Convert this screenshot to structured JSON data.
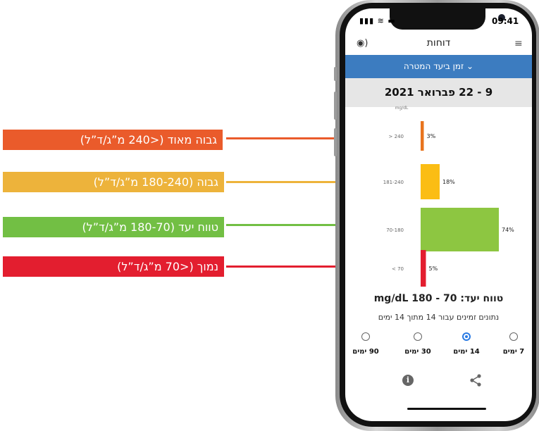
{
  "callouts": [
    {
      "label": "גבוה מאוד (<240 מ”ג/ד”ל)",
      "color": "#ea5b2b"
    },
    {
      "label": "גבוה (180-240 מ”ג/ד”ל)",
      "color": "#edb33b"
    },
    {
      "label": "טווח יעד (180-70 מ”ג/ד”ל)",
      "color": "#72bf44"
    },
    {
      "label": "נמוך (<70 מ”ג/ד”ל)",
      "color": "#e31e2f"
    }
  ],
  "status": {
    "time": "09:41"
  },
  "nav": {
    "title": "דוחות"
  },
  "filter": {
    "label": "זמן ביעד המטרה",
    "icon": "chevron-down-icon"
  },
  "date_range": "9 - 22 פברואר 2021",
  "chart_data": {
    "type": "bar",
    "orientation": "horizontal",
    "unit_label": "mg/dL",
    "categories": [
      "> 240",
      "181-240",
      "70-180",
      "< 70"
    ],
    "values": [
      3,
      18,
      74,
      5
    ],
    "value_labels": [
      "3%",
      "18%",
      "74%",
      "5%"
    ],
    "colors": [
      "#e8741e",
      "#fbbd14",
      "#8dc641",
      "#e31e2f"
    ],
    "xlim": [
      0,
      100
    ]
  },
  "target_range": "טווח יעד: 70 - 180 mg/dL",
  "data_note": "נתונים זמינים עבור 14 מתוך 14 ימים",
  "period_options": [
    {
      "label": "7 ימים",
      "selected": false
    },
    {
      "label": "14 ימים",
      "selected": true
    },
    {
      "label": "30 ימים",
      "selected": false
    },
    {
      "label": "90 ימים",
      "selected": false
    }
  ],
  "icons": {
    "info": "info-icon",
    "share": "share-icon",
    "menu": "hamburger-icon",
    "sound": "sound-icon"
  }
}
